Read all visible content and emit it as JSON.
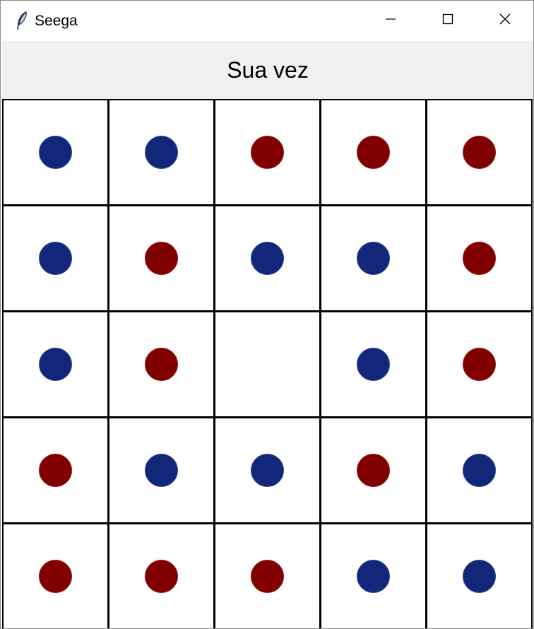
{
  "window": {
    "title": "Seega",
    "icon": "feather-icon",
    "controls": [
      "minimize-icon",
      "maximize-icon",
      "close-icon"
    ]
  },
  "status": {
    "text": "Sua vez"
  },
  "colors": {
    "blue_piece": "#13277a",
    "red_piece": "#800000",
    "grid_line": "#000000",
    "status_bg": "#f0f0f0"
  },
  "board": {
    "rows": 5,
    "cols": 5,
    "cells": [
      [
        "blue",
        "blue",
        "red",
        "red",
        "red"
      ],
      [
        "blue",
        "red",
        "blue",
        "blue",
        "red"
      ],
      [
        "blue",
        "red",
        "empty",
        "blue",
        "red"
      ],
      [
        "red",
        "blue",
        "blue",
        "red",
        "blue"
      ],
      [
        "red",
        "red",
        "red",
        "blue",
        "blue"
      ]
    ]
  }
}
